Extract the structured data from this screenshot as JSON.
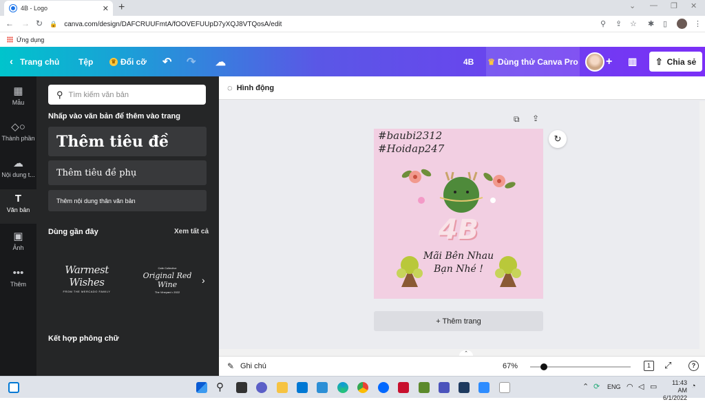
{
  "browser": {
    "tab_title": "4B - Logo",
    "tab_close": "✕",
    "new_tab": "+",
    "url": "canva.com/design/DAFCRUUFmtA/fOOVEFUUpD7yXQJ8VTQosA/edit",
    "bookmark_label": "Ứng dụng"
  },
  "header": {
    "home_label": "Trang chủ",
    "file_label": "Tệp",
    "resize_label": "Đổi cỡ",
    "design_title": "4B",
    "pro_label": "Dùng thử Canva Pro",
    "share_label": "Chia sẻ",
    "add_label": "+"
  },
  "rail": {
    "items": [
      {
        "label": "Mẫu",
        "icon": "template-icon"
      },
      {
        "label": "Thành phần",
        "icon": "elements-icon"
      },
      {
        "label": "Nội dung t...",
        "icon": "upload-icon"
      },
      {
        "label": "Văn bản",
        "icon": "text-icon"
      },
      {
        "label": "Ảnh",
        "icon": "photo-icon"
      },
      {
        "label": "Thêm",
        "icon": "more-icon"
      }
    ]
  },
  "panel": {
    "search_placeholder": "Tìm kiếm văn bản",
    "click_hint": "Nhấp vào văn bản để thêm vào trang",
    "heading_btn": "Thêm tiêu đề",
    "subheading_btn": "Thêm tiêu đề phụ",
    "body_btn": "Thêm nội dung thân văn bản",
    "recent_label": "Dùng gần đây",
    "see_all": "Xem tất cả",
    "recent_items": [
      {
        "main": "Warmest Wishes",
        "sub": "FROM THE MERCADO FAMILY"
      },
      {
        "top": "Cafe Collective",
        "main": "Original Red Wine",
        "sub": "The Vineyard • 2022"
      }
    ],
    "font_combos_label": "Kết hợp phông chữ"
  },
  "toolbar": {
    "animate_label": "Hình động"
  },
  "design": {
    "hashtag1": "#baubi2312",
    "hashtag2": "#Hoidap247",
    "big_text": "4B",
    "line1": "Mãi Bên Nhau",
    "line2": "Bạn Nhé !",
    "background": "#f2cfe2"
  },
  "add_page_label": "+ Thêm trang",
  "footer": {
    "notes_label": "Ghi chú",
    "zoom": "67%",
    "zoom_fraction": 0.67,
    "page_count": "1"
  },
  "taskbar": {
    "lang": "ENG",
    "time": "11:43 AM",
    "date": "6/1/2022"
  },
  "colors": {
    "header_start": "#00c4cc",
    "header_end": "#7b2ff7",
    "rail_bg": "#18191b",
    "panel_bg": "#252627",
    "canvas_bg": "#ebecf0"
  }
}
